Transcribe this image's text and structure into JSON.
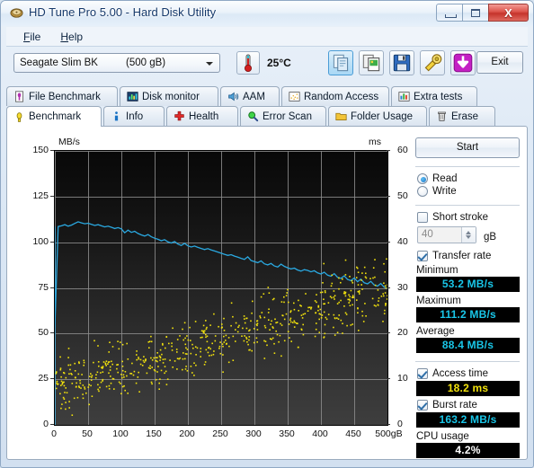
{
  "window": {
    "title": "HD Tune Pro 5.00 - Hard Disk Utility",
    "icon": "harddisk-icon",
    "buttons": {
      "minimize": "minimize-icon",
      "maximize": "maximize-icon",
      "close": "X"
    }
  },
  "menu": {
    "items": [
      {
        "label": "File",
        "accel": "F"
      },
      {
        "label": "Help",
        "accel": "H"
      }
    ]
  },
  "toolbar": {
    "drive": {
      "name": "Seagate Slim BK",
      "capacity": "(500 gB)"
    },
    "temperature": "25°C",
    "temp_icon": "thermometer-icon",
    "icons": [
      {
        "name": "copy-icon",
        "selected": true
      },
      {
        "name": "copy-image-icon",
        "selected": false
      },
      {
        "name": "save-disk-icon",
        "selected": false
      },
      {
        "name": "tools-icon",
        "selected": false
      },
      {
        "name": "download-arrow-icon",
        "selected": false
      }
    ],
    "exit_label": "Exit"
  },
  "tabs": {
    "row1": [
      {
        "label": "File Benchmark",
        "icon": "file-benchmark-icon",
        "active": false
      },
      {
        "label": "Disk monitor",
        "icon": "disk-monitor-icon",
        "active": false
      },
      {
        "label": "AAM",
        "icon": "speaker-icon",
        "active": false
      },
      {
        "label": "Random Access",
        "icon": "random-access-icon",
        "active": false
      },
      {
        "label": "Extra tests",
        "icon": "extra-tests-icon",
        "active": false
      }
    ],
    "row2": [
      {
        "label": "Benchmark",
        "icon": "benchmark-icon",
        "active": true
      },
      {
        "label": "Info",
        "icon": "info-icon",
        "active": false
      },
      {
        "label": "Health",
        "icon": "health-icon",
        "active": false
      },
      {
        "label": "Error Scan",
        "icon": "error-scan-icon",
        "active": false
      },
      {
        "label": "Folder Usage",
        "icon": "folder-icon",
        "active": false
      },
      {
        "label": "Erase",
        "icon": "trash-icon",
        "active": false
      }
    ]
  },
  "sidebar": {
    "start_label": "Start",
    "mode": {
      "read_label": "Read",
      "write_label": "Write",
      "selected": "Read"
    },
    "short_stroke": {
      "label": "Short stroke",
      "checked": false,
      "value": "40",
      "unit": "gB"
    },
    "transfer_rate": {
      "label": "Transfer rate",
      "checked": true
    },
    "results": [
      {
        "label": "Minimum",
        "value": "53.2 MB/s",
        "color": "cyan"
      },
      {
        "label": "Maximum",
        "value": "111.2 MB/s",
        "color": "cyan"
      },
      {
        "label": "Average",
        "value": "88.4 MB/s",
        "color": "cyan"
      }
    ],
    "access_time": {
      "label": "Access time",
      "checked": true,
      "value": "18.2 ms",
      "color": "yellow"
    },
    "burst_rate": {
      "label": "Burst rate",
      "checked": true,
      "value": "163.2 MB/s",
      "color": "cyan"
    },
    "cpu_usage": {
      "label": "CPU usage",
      "value": "4.2%",
      "color": "white"
    }
  },
  "chart_data": {
    "type": "line",
    "title": "",
    "xlabel": "gB",
    "ylabel": "MB/s",
    "y2label": "ms",
    "xlim": [
      0,
      500
    ],
    "ylim": [
      0,
      150
    ],
    "y2lim": [
      0,
      60
    ],
    "grid": true,
    "xticks": [
      0,
      50,
      100,
      150,
      200,
      250,
      300,
      350,
      400,
      450,
      500
    ],
    "xticklabels": [
      "0",
      "50",
      "100",
      "150",
      "200",
      "250",
      "300",
      "350",
      "400",
      "450",
      "500gB"
    ],
    "yticks": [
      0,
      25,
      50,
      75,
      100,
      125,
      150
    ],
    "y2ticks": [
      0,
      10,
      20,
      30,
      40,
      50,
      60
    ],
    "series": [
      {
        "name": "Transfer rate",
        "type": "line",
        "color": "#2aa8e0",
        "axis": "left",
        "x": [
          0,
          5,
          10,
          15,
          20,
          25,
          30,
          35,
          40,
          45,
          50,
          55,
          60,
          65,
          70,
          75,
          80,
          85,
          90,
          95,
          100,
          105,
          110,
          115,
          120,
          125,
          130,
          135,
          140,
          145,
          150,
          155,
          160,
          165,
          170,
          175,
          180,
          185,
          190,
          195,
          200,
          205,
          210,
          215,
          220,
          225,
          230,
          235,
          240,
          245,
          250,
          255,
          260,
          265,
          270,
          275,
          280,
          285,
          290,
          295,
          300,
          305,
          310,
          315,
          320,
          325,
          330,
          335,
          340,
          345,
          350,
          355,
          360,
          365,
          370,
          375,
          380,
          385,
          390,
          395,
          400,
          405,
          410,
          415,
          420,
          425,
          430,
          435,
          440,
          445,
          450,
          455,
          460,
          465,
          470,
          475,
          480,
          485,
          490,
          495,
          500
        ],
        "y": [
          53.2,
          108.6,
          109.0,
          109.6,
          108.8,
          109.4,
          110.3,
          111.2,
          110.6,
          110.1,
          110.4,
          109.8,
          109.2,
          109.6,
          109.0,
          108.4,
          108.8,
          108.2,
          107.5,
          108.0,
          107.3,
          105.2,
          106.6,
          105.4,
          106.0,
          104.8,
          104.0,
          103.4,
          104.2,
          103.0,
          102.2,
          101.6,
          100.8,
          101.4,
          100.2,
          99.6,
          100.4,
          99.0,
          98.2,
          99.4,
          98.0,
          97.4,
          97.9,
          97.2,
          96.6,
          96.0,
          96.5,
          95.8,
          95.2,
          94.6,
          94.0,
          93.4,
          92.8,
          93.2,
          92.4,
          91.8,
          91.2,
          90.6,
          92.0,
          90.0,
          89.4,
          88.8,
          89.8,
          88.2,
          87.6,
          88.4,
          87.0,
          86.4,
          88.0,
          86.8,
          86.0,
          85.4,
          85.8,
          84.8,
          84.2,
          85.0,
          84.6,
          83.8,
          84.4,
          83.2,
          82.6,
          83.6,
          82.0,
          81.4,
          82.8,
          80.8,
          80.2,
          81.6,
          79.6,
          79.0,
          80.4,
          78.4,
          79.8,
          77.8,
          77.2,
          78.6,
          76.6,
          76.0,
          77.4,
          75.4,
          74.8
        ]
      },
      {
        "name": "Access time",
        "type": "scatter",
        "color": "#f2e20c",
        "axis": "right",
        "note": "random scatter of ~600 access-time samples rising from ~8 ms at 0 gB to ~30 ms at 500 gB, mean 18.2 ms",
        "mean": 18.2,
        "start_ms": 8,
        "end_ms": 30,
        "spread_ms": 9,
        "count": 620
      }
    ]
  }
}
